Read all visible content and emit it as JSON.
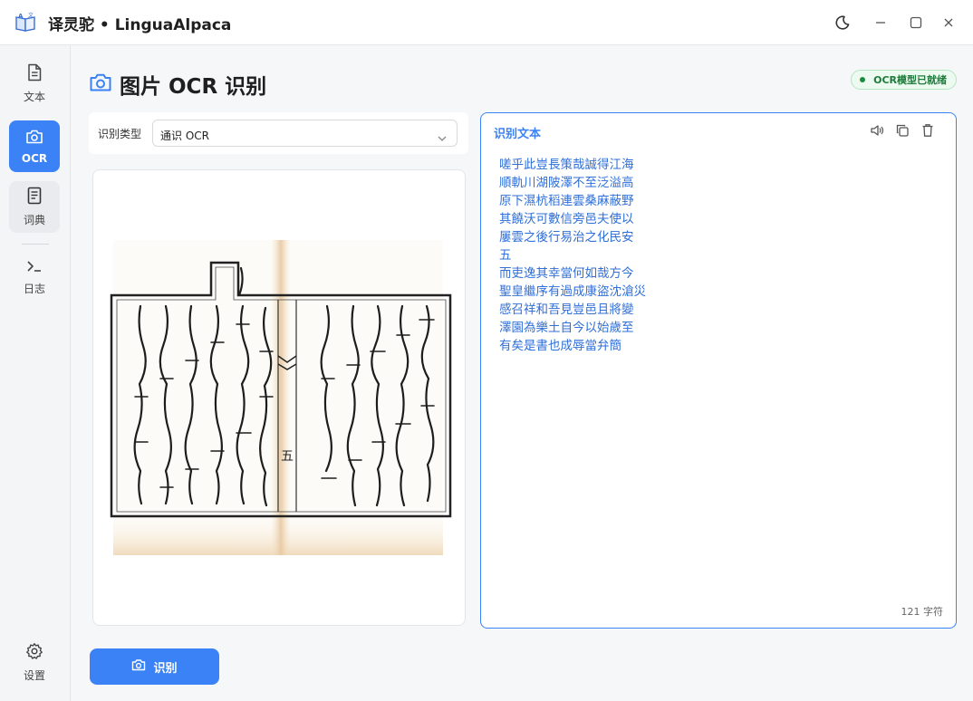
{
  "app": {
    "title": "译灵驼 • LinguaAlpaca"
  },
  "window_controls": [
    "moon-icon",
    "minimize-icon",
    "maximize-icon",
    "close-icon"
  ],
  "sidebar": {
    "items": [
      {
        "label": "文本",
        "icon": "document-icon",
        "active": false
      },
      {
        "label": "OCR",
        "icon": "camera-icon",
        "active": true
      },
      {
        "label": "词典",
        "icon": "book-icon",
        "active": false
      },
      {
        "label": "日志",
        "icon": "terminal-icon",
        "active": false
      }
    ],
    "settings_label": "设置"
  },
  "page": {
    "title": "图片 OCR 识别",
    "status_badge": "OCR模型已就绪"
  },
  "recognition_type": {
    "label": "识别类型",
    "value": "通识 OCR"
  },
  "image_panel": {
    "page_number_glyph": "五"
  },
  "text_panel": {
    "title": "识别文本",
    "lines": [
      "嗟乎此豈長策哉誠得江海",
      "順軌川湖陂澤不至泛溢高",
      "原下濕杭稻連雲桑麻蔽野",
      "其饒沃可數信旁邑夫使以",
      "屢雲之後行易治之化民安",
      "五",
      "而吏逸其幸當何如哉方今",
      "聖皇繼序有過成康盜沈滄災",
      "感召祥和吾見豈邑且將變",
      "澤園為樂土自今以始歲至",
      "有矣是書也成辱當弁簡"
    ],
    "char_count": "121 字符"
  },
  "actions": {
    "recognize_label": "识别"
  },
  "colors": {
    "accent": "#3b82f6",
    "status_green": "#1e7a3a"
  }
}
